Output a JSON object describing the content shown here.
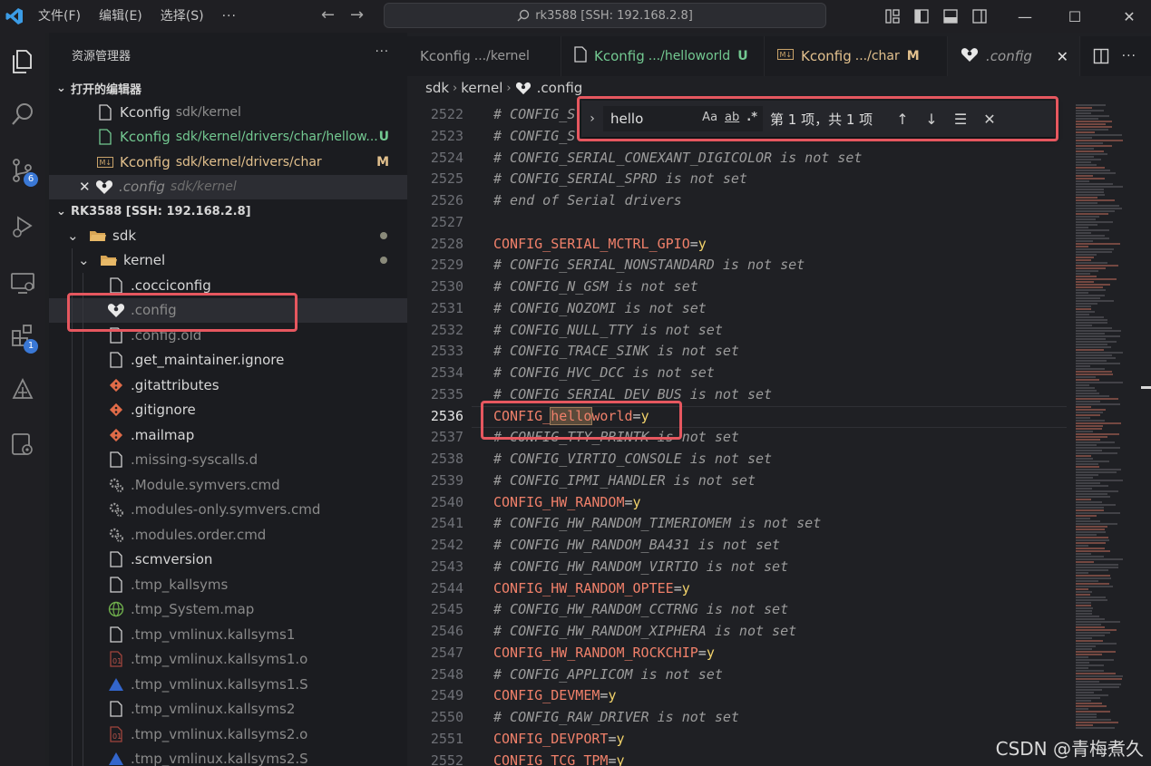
{
  "titlebar": {
    "menu": [
      "文件(F)",
      "编辑(E)",
      "选择(S)",
      "···"
    ],
    "command_center": "rk3588 [SSH: 192.168.2.8]"
  },
  "activity_bar": {
    "badges": {
      "source_control": "6",
      "extensions": "1"
    }
  },
  "sidebar": {
    "title": "资源管理器",
    "more": "···",
    "open_editors_title": "打开的编辑器",
    "open_editors": [
      {
        "name": "Kconfig",
        "path": "sdk/kernel",
        "status": ""
      },
      {
        "name": "Kconfig",
        "path": "sdk/kernel/drivers/char/hellow...",
        "status": "U"
      },
      {
        "name": "Kconfig",
        "path": "sdk/kernel/drivers/char",
        "status": "M"
      },
      {
        "name": ".config",
        "path": "sdk/kernel",
        "status": ""
      }
    ],
    "workspace_title": "RK3588 [SSH: 192.168.2.8]",
    "folders": {
      "sdk": "sdk",
      "kernel": "kernel"
    },
    "files": [
      ".cocciconfig",
      ".config",
      ".config.old",
      ".get_maintainer.ignore",
      ".gitattributes",
      ".gitignore",
      ".mailmap",
      ".missing-syscalls.d",
      ".Module.symvers.cmd",
      ".modules-only.symvers.cmd",
      ".modules.order.cmd",
      ".scmversion",
      ".tmp_kallsyms",
      ".tmp_System.map",
      ".tmp_vmlinux.kallsyms1",
      ".tmp_vmlinux.kallsyms1.o",
      ".tmp_vmlinux.kallsyms1.S",
      ".tmp_vmlinux.kallsyms2",
      ".tmp_vmlinux.kallsyms2.o",
      ".tmp_vmlinux.kallsyms2.S"
    ]
  },
  "tabs": [
    {
      "name": "Kconfig",
      "path": ".../kernel",
      "status": ""
    },
    {
      "name": "Kconfig",
      "path": ".../helloworld",
      "status": "U"
    },
    {
      "name": "Kconfig",
      "path": ".../char",
      "status": "M"
    },
    {
      "name": ".config",
      "path": "",
      "status": ""
    }
  ],
  "breadcrumb": [
    "sdk",
    "kernel",
    ".config"
  ],
  "find": {
    "query": "hello",
    "opt_case": "Aa",
    "opt_word": "ab",
    "opt_regex": ".*",
    "result": "第 1 项，共 1 项"
  },
  "editor": {
    "current_line": "2536",
    "lines": [
      {
        "n": "2522",
        "type": "comment",
        "text": "# CONFIG_S"
      },
      {
        "n": "2523",
        "type": "comment",
        "text": "# CONFIG_S"
      },
      {
        "n": "2524",
        "type": "comment",
        "text": "# CONFIG_SERIAL_CONEXANT_DIGICOLOR is not set"
      },
      {
        "n": "2525",
        "type": "comment",
        "text": "# CONFIG_SERIAL_SPRD is not set"
      },
      {
        "n": "2526",
        "type": "comment",
        "text": "# end of Serial drivers"
      },
      {
        "n": "2527",
        "type": "blank",
        "text": ""
      },
      {
        "n": "2528",
        "type": "config",
        "key": "CONFIG_SERIAL_MCTRL_GPIO",
        "value": "y"
      },
      {
        "n": "2529",
        "type": "comment",
        "text": "# CONFIG_SERIAL_NONSTANDARD is not set"
      },
      {
        "n": "2530",
        "type": "comment",
        "text": "# CONFIG_N_GSM is not set"
      },
      {
        "n": "2531",
        "type": "comment",
        "text": "# CONFIG_NOZOMI is not set"
      },
      {
        "n": "2532",
        "type": "comment",
        "text": "# CONFIG_NULL_TTY is not set"
      },
      {
        "n": "2533",
        "type": "comment",
        "text": "# CONFIG_TRACE_SINK is not set"
      },
      {
        "n": "2534",
        "type": "comment",
        "text": "# CONFIG_HVC_DCC is not set"
      },
      {
        "n": "2535",
        "type": "comment",
        "text": "# CONFIG_SERIAL_DEV_BUS is not set"
      },
      {
        "n": "2536",
        "type": "match",
        "prefix": "CONFIG_",
        "match": "hello",
        "suffix": "world",
        "value": "y"
      },
      {
        "n": "2537",
        "type": "comment",
        "text": "# CONFIG_TTY_PRINTK is not set"
      },
      {
        "n": "2538",
        "type": "comment",
        "text": "# CONFIG_VIRTIO_CONSOLE is not set"
      },
      {
        "n": "2539",
        "type": "comment",
        "text": "# CONFIG_IPMI_HANDLER is not set"
      },
      {
        "n": "2540",
        "type": "config",
        "key": "CONFIG_HW_RANDOM",
        "value": "y"
      },
      {
        "n": "2541",
        "type": "comment",
        "text": "# CONFIG_HW_RANDOM_TIMERIOMEM is not set"
      },
      {
        "n": "2542",
        "type": "comment",
        "text": "# CONFIG_HW_RANDOM_BA431 is not set"
      },
      {
        "n": "2543",
        "type": "comment",
        "text": "# CONFIG_HW_RANDOM_VIRTIO is not set"
      },
      {
        "n": "2544",
        "type": "config",
        "key": "CONFIG_HW_RANDOM_OPTEE",
        "value": "y"
      },
      {
        "n": "2545",
        "type": "comment",
        "text": "# CONFIG_HW_RANDOM_CCTRNG is not set"
      },
      {
        "n": "2546",
        "type": "comment",
        "text": "# CONFIG_HW_RANDOM_XIPHERA is not set"
      },
      {
        "n": "2547",
        "type": "config",
        "key": "CONFIG_HW_RANDOM_ROCKCHIP",
        "value": "y"
      },
      {
        "n": "2548",
        "type": "comment",
        "text": "# CONFIG_APPLICOM is not set"
      },
      {
        "n": "2549",
        "type": "config",
        "key": "CONFIG_DEVMEM",
        "value": "y"
      },
      {
        "n": "2550",
        "type": "comment",
        "text": "# CONFIG_RAW_DRIVER is not set"
      },
      {
        "n": "2551",
        "type": "config",
        "key": "CONFIG_DEVPORT",
        "value": "y"
      },
      {
        "n": "2552",
        "type": "config",
        "key": "CONFIG_TCG_TPM",
        "value": "y"
      }
    ]
  },
  "watermark": "CSDN @青梅煮久"
}
